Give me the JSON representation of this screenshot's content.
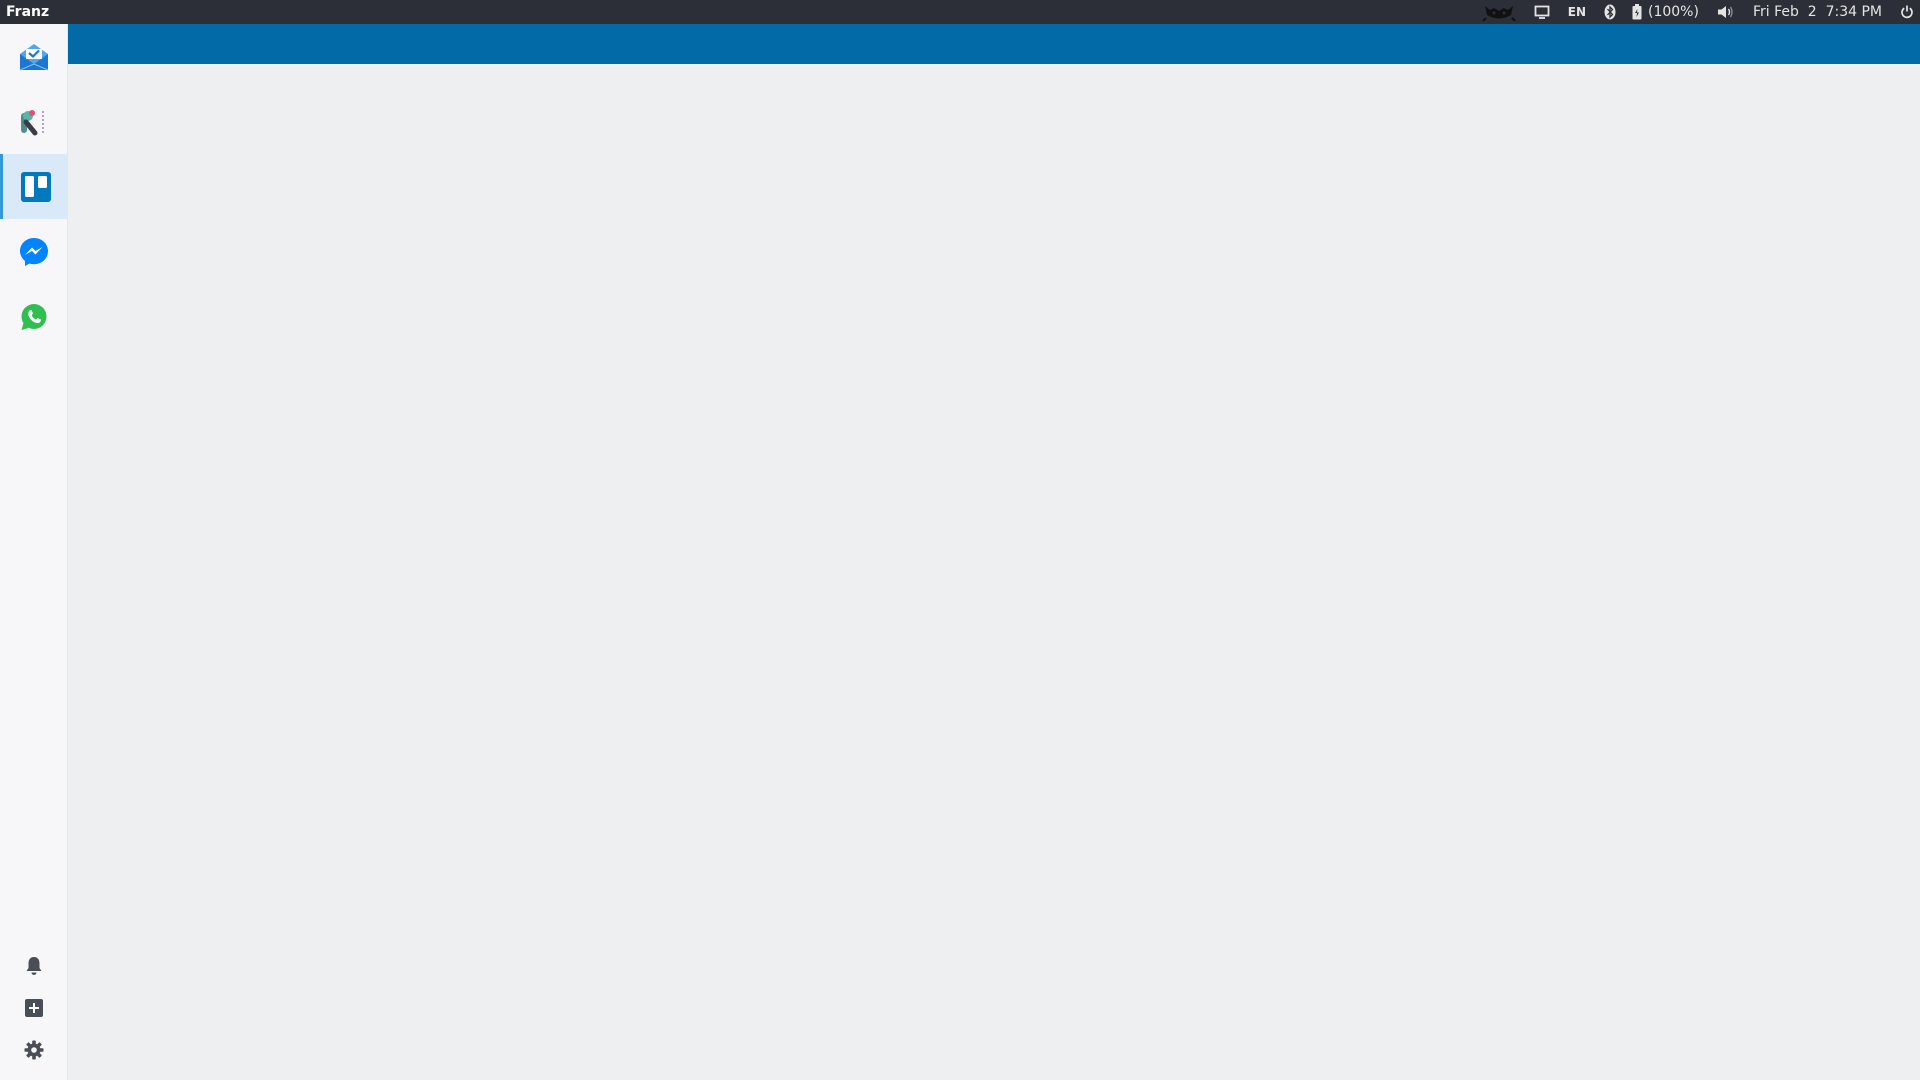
{
  "topbar": {
    "app_name": "Franz",
    "language": "EN",
    "battery_text": "(100%)",
    "datetime": "Fri Feb  2  7:34 PM"
  },
  "icons": {
    "tray": [
      "cat-icon",
      "monitor-icon",
      "bluetooth-icon",
      "battery-icon",
      "volume-icon",
      "power-icon"
    ],
    "services": [
      "inbox-icon",
      "rainmaker-icon",
      "trello-icon",
      "messenger-icon",
      "whatsapp-icon"
    ],
    "tools": [
      "bell-icon",
      "add-icon",
      "gear-icon"
    ]
  },
  "colors": {
    "topbar_bg": "#2c2f37",
    "service_header": "#026aa7",
    "active_service_bg": "#d9e9f7",
    "active_indicator": "#3498db",
    "content_bg": "#eeeff1",
    "sidebar_bg": "#f7f7f9"
  }
}
